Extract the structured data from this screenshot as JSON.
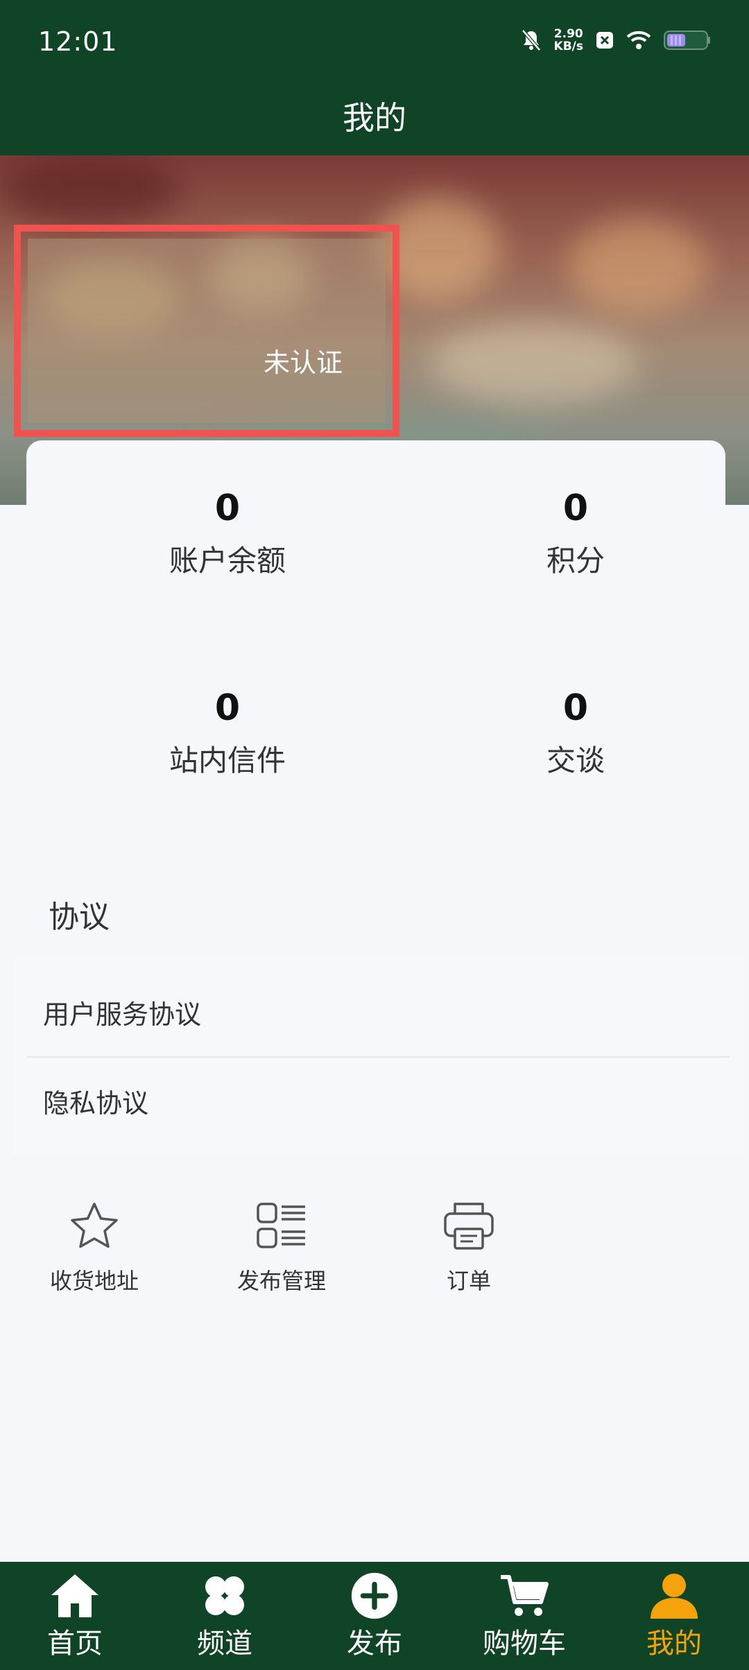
{
  "status_bar": {
    "time": "12:01",
    "net_speed_value": "2.90",
    "net_speed_unit": "KB/s",
    "icons": [
      "bell-mute-icon",
      "close-box-icon",
      "wifi-icon",
      "battery-icon"
    ]
  },
  "header": {
    "title": "我的"
  },
  "profile": {
    "cert_status": "未认证"
  },
  "stats": [
    {
      "value": "0",
      "label": "账户余额"
    },
    {
      "value": "0",
      "label": "积分"
    },
    {
      "value": "0",
      "label": "站内信件"
    },
    {
      "value": "0",
      "label": "交谈"
    }
  ],
  "agreements": {
    "title": "协议",
    "items": [
      "用户服务协议",
      "隐私协议"
    ]
  },
  "quick_actions": [
    {
      "label": "收货地址",
      "icon": "star-icon"
    },
    {
      "label": "发布管理",
      "icon": "list-grid-icon"
    },
    {
      "label": "订单",
      "icon": "printer-icon"
    }
  ],
  "bottom_nav": [
    {
      "label": "首页",
      "icon": "home-icon"
    },
    {
      "label": "频道",
      "icon": "clover-icon"
    },
    {
      "label": "发布",
      "icon": "plus-circle-icon"
    },
    {
      "label": "购物车",
      "icon": "cart-icon"
    },
    {
      "label": "我的",
      "icon": "user-icon",
      "active": true
    }
  ],
  "colors": {
    "header_bg": "#0f4427",
    "accent_active": "#f6a20a",
    "highlight_border": "#ef524f",
    "page_bg": "#f6f7fa"
  }
}
